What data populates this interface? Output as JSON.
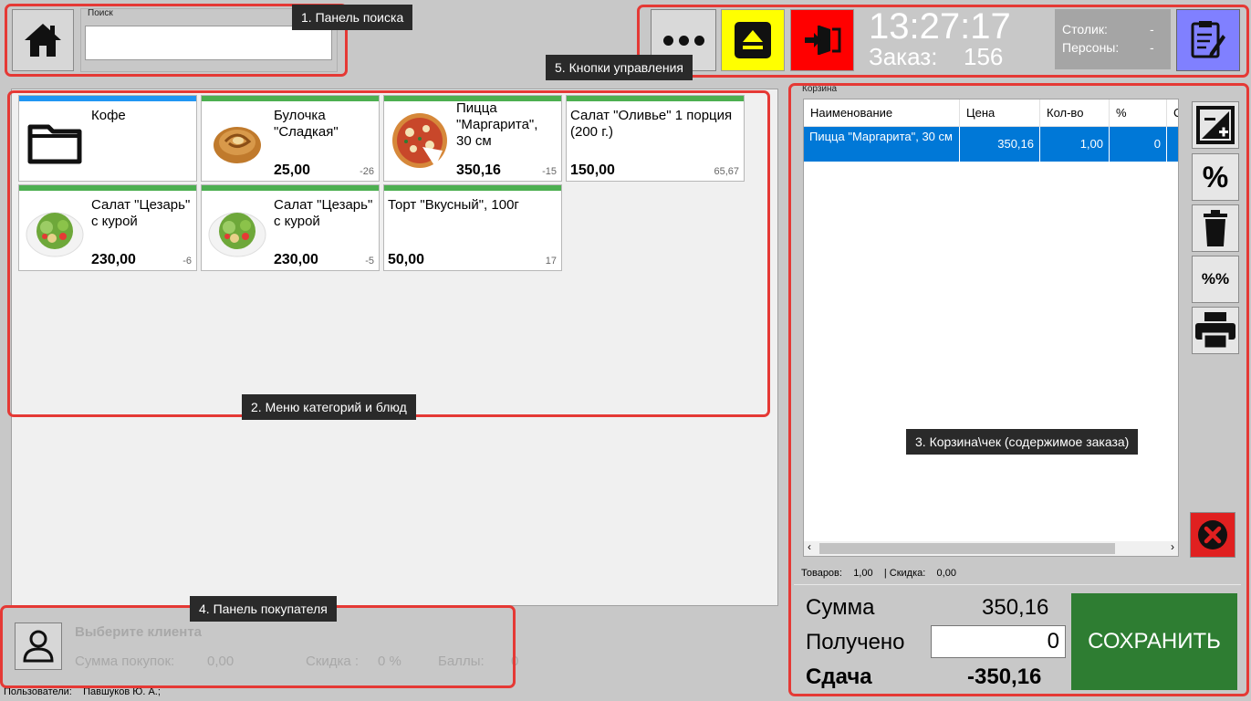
{
  "search": {
    "label": "Поиск",
    "value": "",
    "placeholder": ""
  },
  "header": {
    "clock": "13:27:17",
    "order_label": "Заказ:",
    "order_number": "156",
    "table_label": "Столик:",
    "table_value": "-",
    "persons_label": "Персоны:",
    "persons_value": "-",
    "colors": {
      "eject": "#ffff00",
      "exit": "#ff0000",
      "notes": "#8080ff"
    }
  },
  "menu": {
    "items": [
      {
        "name": "Кофе",
        "price": "",
        "stock": "",
        "bar": "blue",
        "icon": "folder-icon"
      },
      {
        "name": "Булочка \"Сладкая\"",
        "price": "25,00",
        "stock": "-26",
        "bar": "green",
        "icon": "bun-image"
      },
      {
        "name": "Пицца \"Маргарита\", 30 см",
        "price": "350,16",
        "stock": "-15",
        "bar": "green",
        "icon": "pizza-image"
      },
      {
        "name": "Салат \"Оливье\" 1 порция (200 г.)",
        "price": "150,00",
        "stock": "65,67",
        "bar": "green",
        "icon": ""
      },
      {
        "name": "Салат \"Цезарь\" с курой",
        "price": "230,00",
        "stock": "-6",
        "bar": "green",
        "icon": "salad-image"
      },
      {
        "name": "Салат \"Цезарь\" с курой",
        "price": "230,00",
        "stock": "-5",
        "bar": "green",
        "icon": "salad-image"
      },
      {
        "name": "Торт \"Вкусный\", 100г",
        "price": "50,00",
        "stock": "17",
        "bar": "green",
        "icon": ""
      }
    ]
  },
  "customer": {
    "title": "Выберите клиента",
    "purchases_label": "Сумма покупок:",
    "purchases_value": "0,00",
    "discount_label": "Скидка :",
    "discount_value": "0 %",
    "points_label": "Баллы:",
    "points_value": "0"
  },
  "users": {
    "label": "Пользователи:",
    "value": "Павшуков Ю. А.;"
  },
  "cart": {
    "label": "Корзина",
    "columns": [
      "Наименование",
      "Цена",
      "Кол-во",
      "%",
      "С"
    ],
    "rows": [
      {
        "name": "Пицца \"Маргарита\", 30 см",
        "price": "350,16",
        "qty": "1,00",
        "percent": "0"
      }
    ],
    "goods_label": "Товаров:",
    "goods_value": "1,00",
    "discount_label": "| Скидка:",
    "discount_value": "0,00"
  },
  "payment": {
    "sum_label": "Сумма",
    "sum_value": "350,16",
    "received_label": "Получено",
    "received_value": "0",
    "change_label": "Сдача",
    "change_value": "-350,16",
    "save_label": "СОХРАНИТЬ",
    "percent_label": "%",
    "double_percent_label": "%%"
  },
  "callouts": {
    "c1": "1. Панель поиска",
    "c2": "2. Меню категорий и блюд",
    "c3": "3. Корзина\\чек (содержимое заказа)",
    "c4": "4. Панель покупателя",
    "c5": "5. Кнопки управления"
  }
}
